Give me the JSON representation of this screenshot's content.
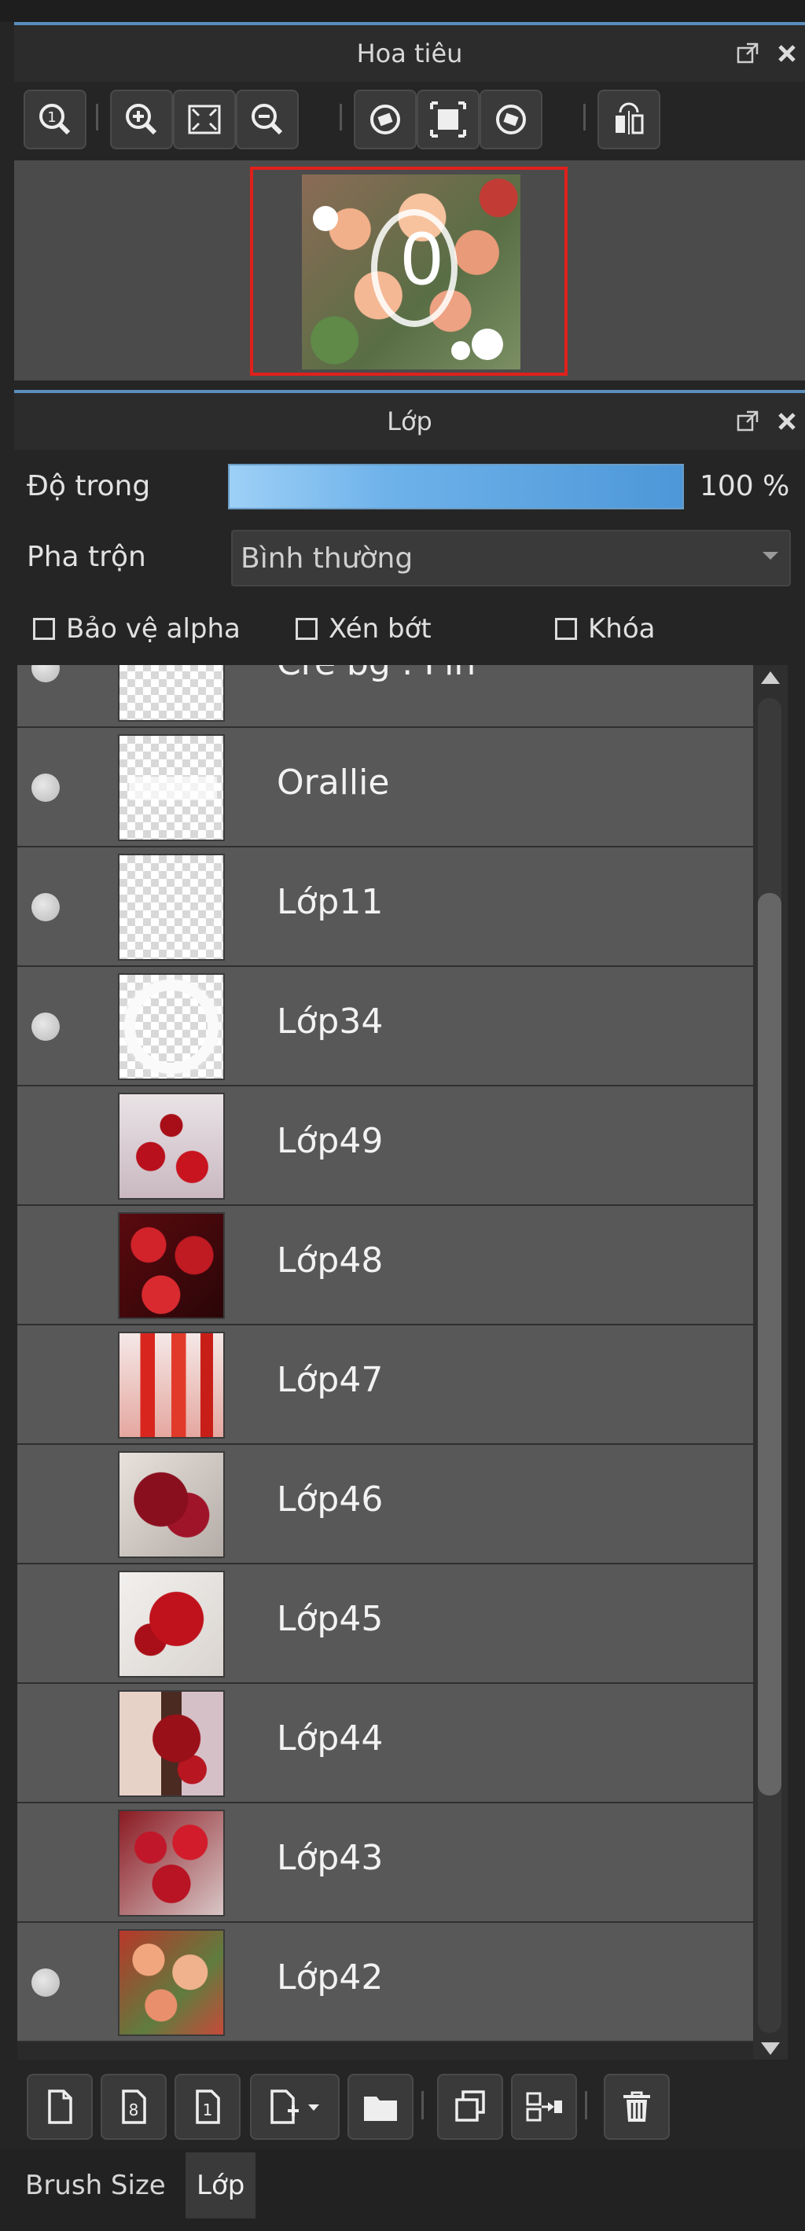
{
  "navigator": {
    "title": "Hoa tiêu",
    "toolbar_icons": [
      "zoom-actual-icon",
      "zoom-in-icon",
      "fit-screen-icon",
      "zoom-out-icon",
      "rotate-left-icon",
      "fit-window-icon",
      "rotate-right-icon",
      "flip-horizontal-icon"
    ],
    "preview_text": "0"
  },
  "layers_panel": {
    "title": "Lớp",
    "opacity_label": "Độ trong",
    "opacity_value": "100 %",
    "opacity_fraction": 1.0,
    "blend_label": "Pha trộn",
    "blend_value": "Bình thường",
    "protect_alpha_label": "Bảo vệ alpha",
    "clip_label": "Xén bớt",
    "lock_label": "Khóa",
    "layers": [
      {
        "name": "Cre bg : Pin",
        "visible": true,
        "thumb": "checker"
      },
      {
        "name": "Orallie",
        "visible": true,
        "thumb": "checker"
      },
      {
        "name": "Lớp11",
        "visible": true,
        "thumb": "checker"
      },
      {
        "name": "Lớp34",
        "visible": true,
        "thumb": "white-ring"
      },
      {
        "name": "Lớp49",
        "visible": false,
        "thumb": "red-jelly"
      },
      {
        "name": "Lớp48",
        "visible": false,
        "thumb": "cherries"
      },
      {
        "name": "Lớp47",
        "visible": false,
        "thumb": "red-popsicles"
      },
      {
        "name": "Lớp46",
        "visible": false,
        "thumb": "cherry-bowl"
      },
      {
        "name": "Lớp45",
        "visible": false,
        "thumb": "roses"
      },
      {
        "name": "Lớp44",
        "visible": false,
        "thumb": "cherry-bouquet"
      },
      {
        "name": "Lớp43",
        "visible": false,
        "thumb": "strawberries"
      },
      {
        "name": "Lớp42",
        "visible": true,
        "thumb": "peaches"
      }
    ],
    "bottom_icons": [
      "new-layer-icon",
      "new-8bit-layer-icon",
      "new-1bit-layer-icon",
      "add-layer-menu-icon",
      "new-folder-icon",
      "duplicate-layer-icon",
      "merge-down-icon",
      "delete-layer-icon"
    ]
  },
  "tabs": [
    {
      "label": "Brush Size",
      "active": false
    },
    {
      "label": "Lớp",
      "active": true
    }
  ],
  "colors": {
    "accent": "#5a8fbd",
    "selection_frame": "#e0201c",
    "layer_row": "#585858",
    "panel_bg": "#252525"
  }
}
